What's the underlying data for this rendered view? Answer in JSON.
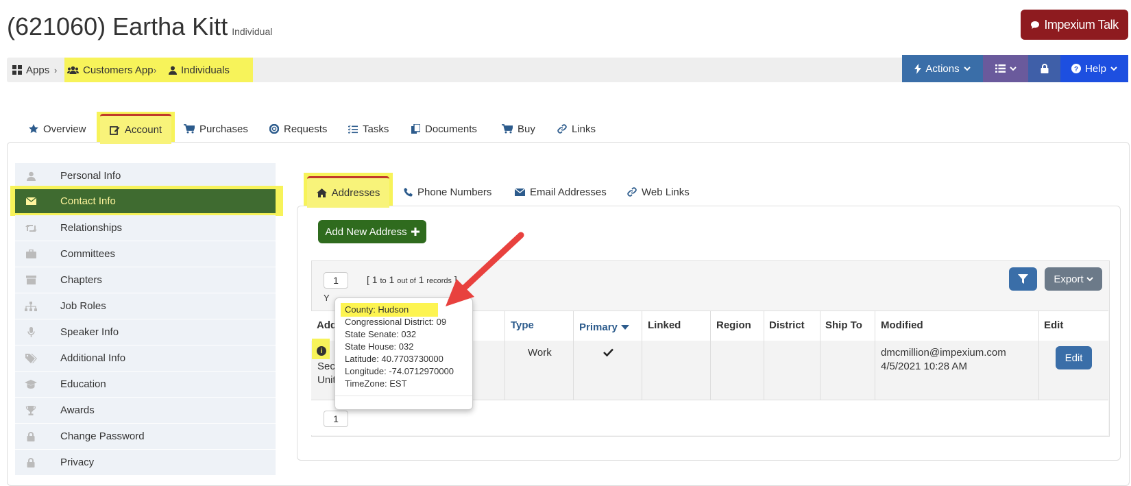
{
  "header": {
    "title": "(621060) Eartha Kitt",
    "subtitle": "Individual",
    "talk_label": "Impexium Talk"
  },
  "breadcrumb": [
    "Apps",
    "Customers App",
    "Individuals"
  ],
  "topbar": {
    "actions_label": "Actions",
    "help_label": "Help"
  },
  "tabs": [
    "Overview",
    "Account",
    "Purchases",
    "Requests",
    "Tasks",
    "Documents",
    "Buy",
    "Links"
  ],
  "sidebar": {
    "items": [
      "Personal Info",
      "Contact Info",
      "Relationships",
      "Committees",
      "Chapters",
      "Job Roles",
      "Speaker Info",
      "Additional Info",
      "Education",
      "Awards",
      "Change Password",
      "Privacy"
    ]
  },
  "subtabs": [
    "Addresses",
    "Phone Numbers",
    "Email Addresses",
    "Web Links"
  ],
  "add_button": "Add New Address",
  "grid": {
    "page": "1",
    "records_open": "[",
    "records_from": "1",
    "records_to_word": "to",
    "records_to": "1",
    "records_outof": "out of",
    "records_total": "1",
    "records_word": "records",
    "records_close": "]",
    "partial_label": "Y",
    "export_label": "Export",
    "columns": [
      "Add",
      "Type",
      "Primary",
      "Linked",
      "Region",
      "District",
      "Ship To",
      "Modified",
      "Edit"
    ],
    "row": {
      "address_line1": "Seca",
      "address_line2": "Unit",
      "type": "Work",
      "modified_by": "dmcmillion@impexium.com",
      "modified_at": "4/5/2021 10:28 AM",
      "edit_label": "Edit"
    },
    "footer_page": "1"
  },
  "popover": {
    "lines": [
      "County: Hudson",
      "Congressional District: 09",
      "State Senate: 032",
      "State House: 032",
      "Latitude: 40.7703730000",
      "Longitude: -74.0712970000",
      "TimeZone: EST"
    ]
  },
  "colors": {
    "talk": "#8e1b1f",
    "actions": "#3a6ea8",
    "menu": "#6a5a9c",
    "lock": "#3f5fa8",
    "help": "#1d4fe0",
    "sidebar_active": "#3f6b30",
    "highlight": "#f7f35a",
    "arrow": "#e8413e"
  }
}
